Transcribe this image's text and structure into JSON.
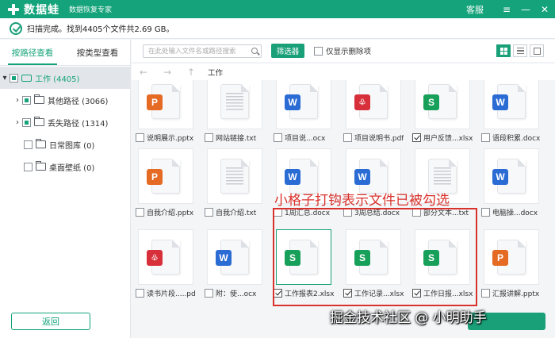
{
  "titlebar": {
    "app_name": "数据蛙",
    "subtitle": "数据恢复专家",
    "service": "客服",
    "menu_icon": "≡",
    "minimize_icon": "—",
    "close_icon": "✕"
  },
  "status": {
    "text": "扫描完成。找到4405个文件共2.69 GB。"
  },
  "sidebar": {
    "tabs": [
      {
        "label": "按路径查看",
        "active": true
      },
      {
        "label": "按类型查看",
        "active": false
      }
    ],
    "tree": [
      {
        "label": "工作 (4405)",
        "expanded": true,
        "check": "partial"
      },
      {
        "label": "其他路径 (3066)",
        "check": "partial"
      },
      {
        "label": "丢失路径 (1314)",
        "check": "partial"
      },
      {
        "label": "日常图库 (0)",
        "check": "none"
      },
      {
        "label": "桌面壁纸 (0)",
        "check": "none"
      }
    ],
    "back_label": "返回"
  },
  "toolbar": {
    "search_placeholder": "在此处输入文件名或路径搜索",
    "filter_label": "筛选器",
    "only_deleted_label": "仅显示删除项"
  },
  "pathbar": {
    "back": "←",
    "forward": "→",
    "up": "↑",
    "path": "工作"
  },
  "files": [
    {
      "name": "说明展示.pptx",
      "type": "P",
      "checked": false
    },
    {
      "name": "网站链接.txt",
      "type": "TXT",
      "checked": false
    },
    {
      "name": "项目说...ocx",
      "type": "W",
      "checked": false
    },
    {
      "name": "项目说明书.pdf",
      "type": "PDF",
      "checked": false
    },
    {
      "name": "用户反馈...xlsx",
      "type": "S",
      "checked": true
    },
    {
      "name": "语段积累.docx",
      "type": "W",
      "checked": false
    },
    {
      "name": "自我介绍.pptx",
      "type": "P",
      "checked": false
    },
    {
      "name": "自我介绍.txt",
      "type": "TXT",
      "checked": false
    },
    {
      "name": "1周汇总.docx",
      "type": "W",
      "checked": false
    },
    {
      "name": "3周总结.docx",
      "type": "W",
      "checked": false
    },
    {
      "name": "部分文本...txt",
      "type": "TXT",
      "checked": false
    },
    {
      "name": "电脑操...docx",
      "type": "W",
      "checked": false
    },
    {
      "name": "读书片段.....pdf",
      "type": "PDF",
      "checked": false
    },
    {
      "name": "附：使...ocx",
      "type": "W",
      "checked": false
    },
    {
      "name": "工作报表2.xlsx",
      "type": "S",
      "checked": true,
      "selected": true
    },
    {
      "name": "工作记录...xlsx",
      "type": "S",
      "checked": true
    },
    {
      "name": "工作日报...xlsx",
      "type": "S",
      "checked": true
    },
    {
      "name": "汇报讲解.pptx",
      "type": "P",
      "checked": false
    }
  ],
  "annotation": {
    "text": "小格子打钩表示文件已被勾选"
  },
  "watermark": {
    "text": "掘金技术社区 @ 小明助手"
  },
  "colors": {
    "accent": "#14a37a",
    "annotation": "#d9312b"
  }
}
